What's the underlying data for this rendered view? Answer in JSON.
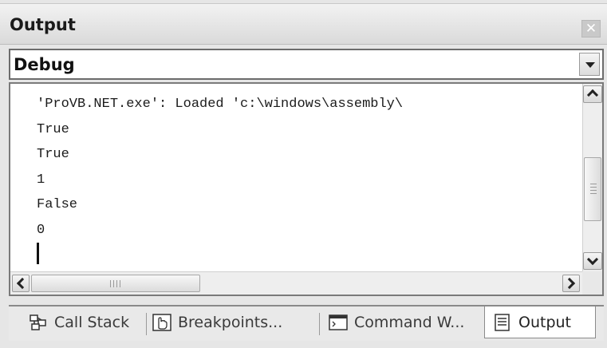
{
  "window": {
    "title": "Output",
    "close_icon": "close-icon"
  },
  "pane_selector": {
    "selected": "Debug"
  },
  "output": {
    "lines": [
      "'ProVB.NET.exe': Loaded 'c:\\windows\\assembly\\",
      "True",
      "True",
      "1",
      "False",
      "0"
    ]
  },
  "scrollbars": {
    "vertical_position": 0.45,
    "horizontal_position": 0.0
  },
  "tabs": [
    {
      "label": "Call Stack",
      "icon": "call-stack-icon",
      "active": false
    },
    {
      "label": "Breakpoints...",
      "icon": "breakpoints-icon",
      "active": false
    },
    {
      "label": "Command W...",
      "icon": "command-window-icon",
      "active": false
    },
    {
      "label": "Output",
      "icon": "output-icon",
      "active": true
    }
  ]
}
